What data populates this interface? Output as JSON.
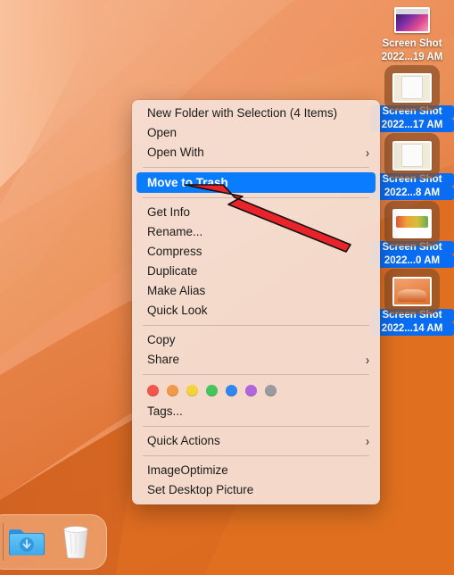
{
  "desktop": {
    "wallpaper_name": "macos-monterey-orange-abstract",
    "background_color": "#E2742A",
    "icons": [
      {
        "name": "screenshot-1",
        "line1": "Screen Shot",
        "line2": "2022...19 AM",
        "selected": false,
        "thumb": "thumb-a"
      },
      {
        "name": "screenshot-2",
        "line1": "Screen Shot",
        "line2": "2022...17 AM",
        "selected": true,
        "thumb": "thumb-doc"
      },
      {
        "name": "screenshot-3",
        "line1": "Screen Shot",
        "line2": "2022...8 AM",
        "selected": true,
        "thumb": "thumb-doc"
      },
      {
        "name": "screenshot-4",
        "line1": "Screen Shot",
        "line2": "2022...0 AM",
        "selected": true,
        "thumb": "thumb-food"
      },
      {
        "name": "screenshot-5",
        "line1": "Screen Shot",
        "line2": "2022...14 AM",
        "selected": true,
        "thumb": "thumb-orange"
      }
    ]
  },
  "context_menu": {
    "highlight_color": "#0A7CFF",
    "background_color": "#F5DED1",
    "items": [
      {
        "label": "New Folder with Selection (4 Items)",
        "submenu": false,
        "highlighted": false
      },
      {
        "label": "Open",
        "submenu": false,
        "highlighted": false
      },
      {
        "label": "Open With",
        "submenu": true,
        "highlighted": false
      },
      {
        "separator": true
      },
      {
        "label": "Move to Trash",
        "submenu": false,
        "highlighted": true
      },
      {
        "separator": true
      },
      {
        "label": "Get Info",
        "submenu": false,
        "highlighted": false
      },
      {
        "label": "Rename...",
        "submenu": false,
        "highlighted": false
      },
      {
        "label": "Compress",
        "submenu": false,
        "highlighted": false
      },
      {
        "label": "Duplicate",
        "submenu": false,
        "highlighted": false
      },
      {
        "label": "Make Alias",
        "submenu": false,
        "highlighted": false
      },
      {
        "label": "Quick Look",
        "submenu": false,
        "highlighted": false
      },
      {
        "separator": true
      },
      {
        "label": "Copy",
        "submenu": false,
        "highlighted": false
      },
      {
        "label": "Share",
        "submenu": true,
        "highlighted": false
      },
      {
        "separator": true
      },
      {
        "tags": true
      },
      {
        "label": "Tags...",
        "submenu": false,
        "highlighted": false
      },
      {
        "separator": true
      },
      {
        "label": "Quick Actions",
        "submenu": true,
        "highlighted": false
      },
      {
        "separator": true
      },
      {
        "label": "ImageOptimize",
        "submenu": false,
        "highlighted": false
      },
      {
        "label": "Set Desktop Picture",
        "submenu": false,
        "highlighted": false
      }
    ],
    "tag_colors": [
      "#F2564C",
      "#F2994A",
      "#F5D33C",
      "#45C65A",
      "#2F88F0",
      "#B濯66E0",
      "#9A9AA0"
    ],
    "tag_swatches": [
      {
        "name": "tag-red",
        "color": "#F2564C"
      },
      {
        "name": "tag-orange",
        "color": "#F2994A"
      },
      {
        "name": "tag-yellow",
        "color": "#F5D33C"
      },
      {
        "name": "tag-green",
        "color": "#45C65A"
      },
      {
        "name": "tag-blue",
        "color": "#2F88F0"
      },
      {
        "name": "tag-purple",
        "color": "#B166E0"
      },
      {
        "name": "tag-gray",
        "color": "#9A9AA0"
      }
    ],
    "submenu_glyph": "›"
  },
  "annotation": {
    "type": "red-arrow",
    "color": "#E8232A",
    "points_to": "Move to Trash"
  },
  "dock": {
    "items": [
      {
        "name": "downloads-folder",
        "label": "Downloads"
      },
      {
        "name": "trash",
        "label": "Trash"
      }
    ]
  }
}
